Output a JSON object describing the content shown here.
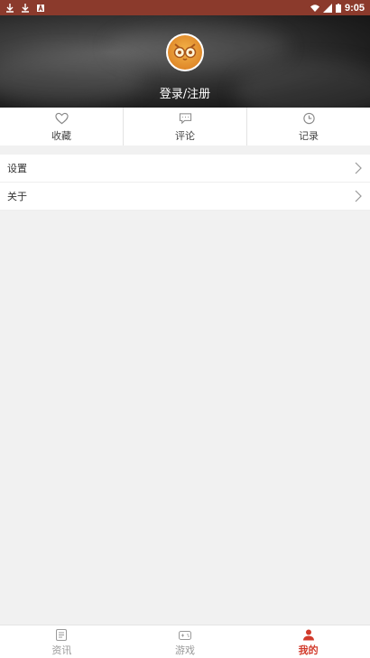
{
  "status_bar": {
    "time": "9:05"
  },
  "profile": {
    "login_label": "登录/注册"
  },
  "quick_tabs": [
    {
      "label": "收藏",
      "icon": "heart-icon"
    },
    {
      "label": "评论",
      "icon": "comment-icon"
    },
    {
      "label": "记录",
      "icon": "clock-icon"
    }
  ],
  "menu": [
    {
      "label": "设置"
    },
    {
      "label": "关于"
    }
  ],
  "bottom_nav": [
    {
      "label": "资讯",
      "icon": "news-icon",
      "active": false
    },
    {
      "label": "游戏",
      "icon": "gamepad-icon",
      "active": false
    },
    {
      "label": "我的",
      "icon": "person-icon",
      "active": true
    }
  ],
  "colors": {
    "status_bar": "#8b3a2c",
    "accent": "#d23b2c",
    "background": "#f1f1f1"
  }
}
